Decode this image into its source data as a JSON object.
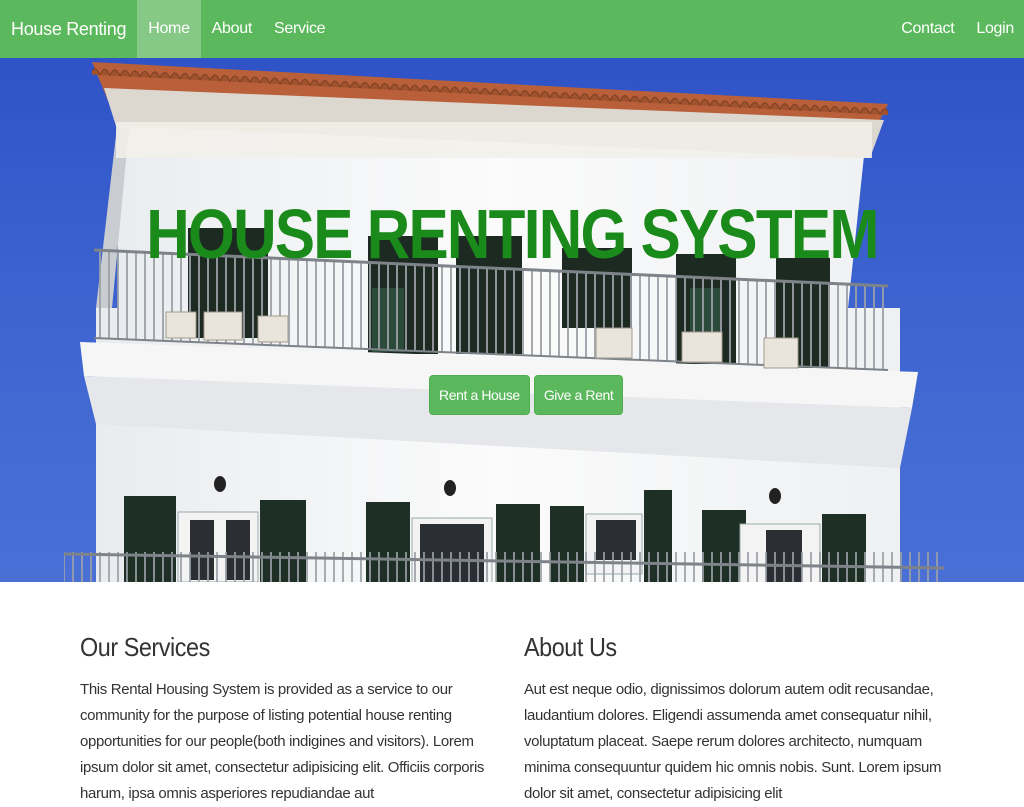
{
  "navbar": {
    "brand": "House Renting",
    "left_links": [
      "Home",
      "About",
      "Service"
    ],
    "right_links": [
      "Contact",
      "Login"
    ],
    "active": "Home",
    "color": "#5cb85c"
  },
  "hero": {
    "title": "HOUSE RENTING SYSTEM",
    "title_color": "#1a8a1a",
    "buttons": {
      "rent": "Rent a House",
      "give": "Give a Rent"
    },
    "background": "apartment-building-photo"
  },
  "services": {
    "heading": "Our Services",
    "text": "This Rental Housing System is provided as a service to our community for the purpose of listing potential house renting opportunities for our people(both indigines and visitors). Lorem ipsum dolor sit amet, consectetur adipisicing elit. Officiis corporis harum, ipsa omnis asperiores repudiandae aut"
  },
  "about": {
    "heading": "About Us",
    "text": "Aut est neque odio, dignissimos dolorum autem odit recusandae, laudantium dolores. Eligendi assumenda amet consequatur nihil, voluptatum placeat. Saepe rerum dolores architecto, numquam minima consequuntur quidem hic omnis nobis. Sunt. Lorem ipsum dolor sit amet, consectetur adipisicing elit"
  }
}
